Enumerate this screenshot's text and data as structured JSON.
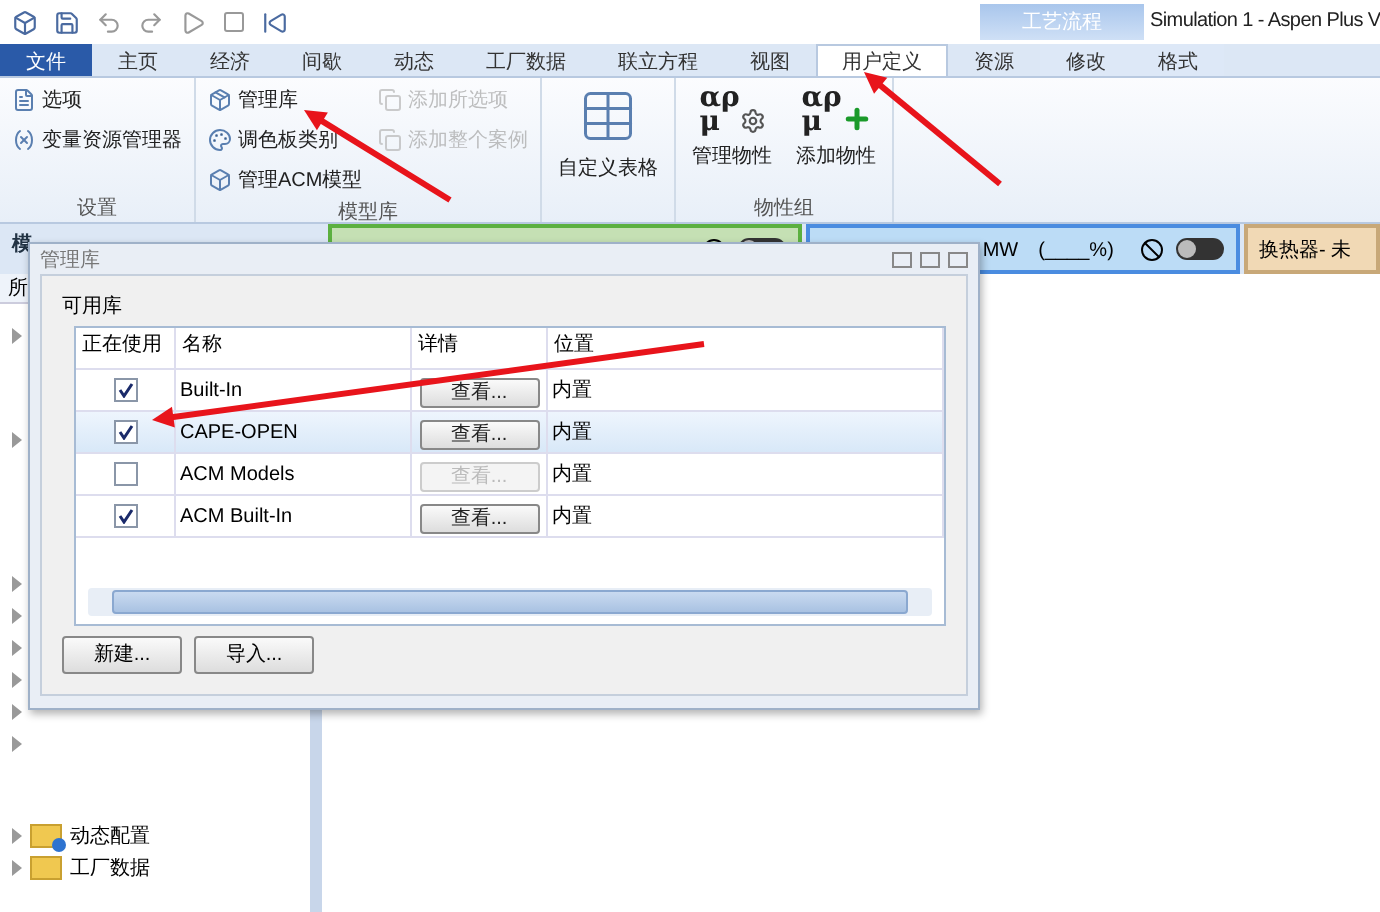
{
  "window": {
    "title": "Simulation 1 - Aspen Plus V",
    "context_tab": "工艺流程"
  },
  "tabs": [
    {
      "label": "文件",
      "kind": "file",
      "selected": false
    },
    {
      "label": "主页",
      "kind": "normal",
      "selected": false
    },
    {
      "label": "经济",
      "kind": "normal",
      "selected": false
    },
    {
      "label": "间歇",
      "kind": "normal",
      "selected": false
    },
    {
      "label": "动态",
      "kind": "normal",
      "selected": false
    },
    {
      "label": "工厂数据",
      "kind": "normal",
      "selected": false
    },
    {
      "label": "联立方程",
      "kind": "normal",
      "selected": false
    },
    {
      "label": "视图",
      "kind": "normal",
      "selected": false
    },
    {
      "label": "用户定义",
      "kind": "normal",
      "selected": true
    },
    {
      "label": "资源",
      "kind": "normal",
      "selected": false
    },
    {
      "label": "修改",
      "kind": "context",
      "selected": false
    },
    {
      "label": "格式",
      "kind": "context",
      "selected": false
    }
  ],
  "ribbon": {
    "groups": [
      {
        "label": "设置",
        "items": [
          {
            "label": "选项",
            "kind": "small",
            "disabled": false
          },
          {
            "label": "变量资源管理器",
            "kind": "small",
            "disabled": false
          }
        ]
      },
      {
        "label": "模型库",
        "items": [
          {
            "label": "管理库",
            "kind": "small",
            "disabled": false
          },
          {
            "label": "调色板类别",
            "kind": "small",
            "disabled": false
          },
          {
            "label": "管理ACM模型",
            "kind": "small",
            "disabled": false
          },
          {
            "label": "添加所选项",
            "kind": "small",
            "disabled": true
          },
          {
            "label": "添加整个案例",
            "kind": "small",
            "disabled": true
          }
        ]
      },
      {
        "items": [
          {
            "label": "自定义表格",
            "kind": "table",
            "disabled": false
          }
        ]
      },
      {
        "label": "物性组",
        "items": [
          {
            "label": "管理物性",
            "kind": "props",
            "symbol": "αρ",
            "symbol_sub": "μ",
            "disabled": false
          },
          {
            "label": "添加物性",
            "kind": "addprops",
            "symbol": "αρ",
            "symbol_sub": "μ",
            "disabled": false
          }
        ]
      }
    ]
  },
  "status_strip": {
    "left_label": "模",
    "panels": [
      {
        "kind": "toggle",
        "color": "#c5e0b4",
        "on": false
      },
      {
        "kind": "toggle",
        "color": "#bcdcf6",
        "text": "MW　(____%)",
        "on": false
      },
      {
        "kind": "text",
        "color": "#f1d9b5",
        "text": "换热器- 未"
      }
    ]
  },
  "left_pane": {
    "filter": "所",
    "tree": [
      {
        "label": "动态配置",
        "kind": "dynamic"
      },
      {
        "label": "工厂数据",
        "kind": "folder"
      }
    ]
  },
  "dialog": {
    "title": "管理库",
    "group_label": "可用库",
    "columns": [
      "正在使用",
      "名称",
      "详情",
      "位置"
    ],
    "rows": [
      {
        "checked": true,
        "name": "Built-In",
        "button": "查看...",
        "button_disabled": false,
        "location": "内置",
        "selected": false
      },
      {
        "checked": true,
        "name": "CAPE-OPEN",
        "button": "查看...",
        "button_disabled": false,
        "location": "内置",
        "selected": true
      },
      {
        "checked": false,
        "name": "ACM Models",
        "button": "查看...",
        "button_disabled": true,
        "location": "内置",
        "selected": false
      },
      {
        "checked": true,
        "name": "ACM Built-In",
        "button": "查看...",
        "button_disabled": false,
        "location": "内置",
        "selected": false
      }
    ],
    "buttons": [
      "新建...",
      "导入..."
    ]
  }
}
